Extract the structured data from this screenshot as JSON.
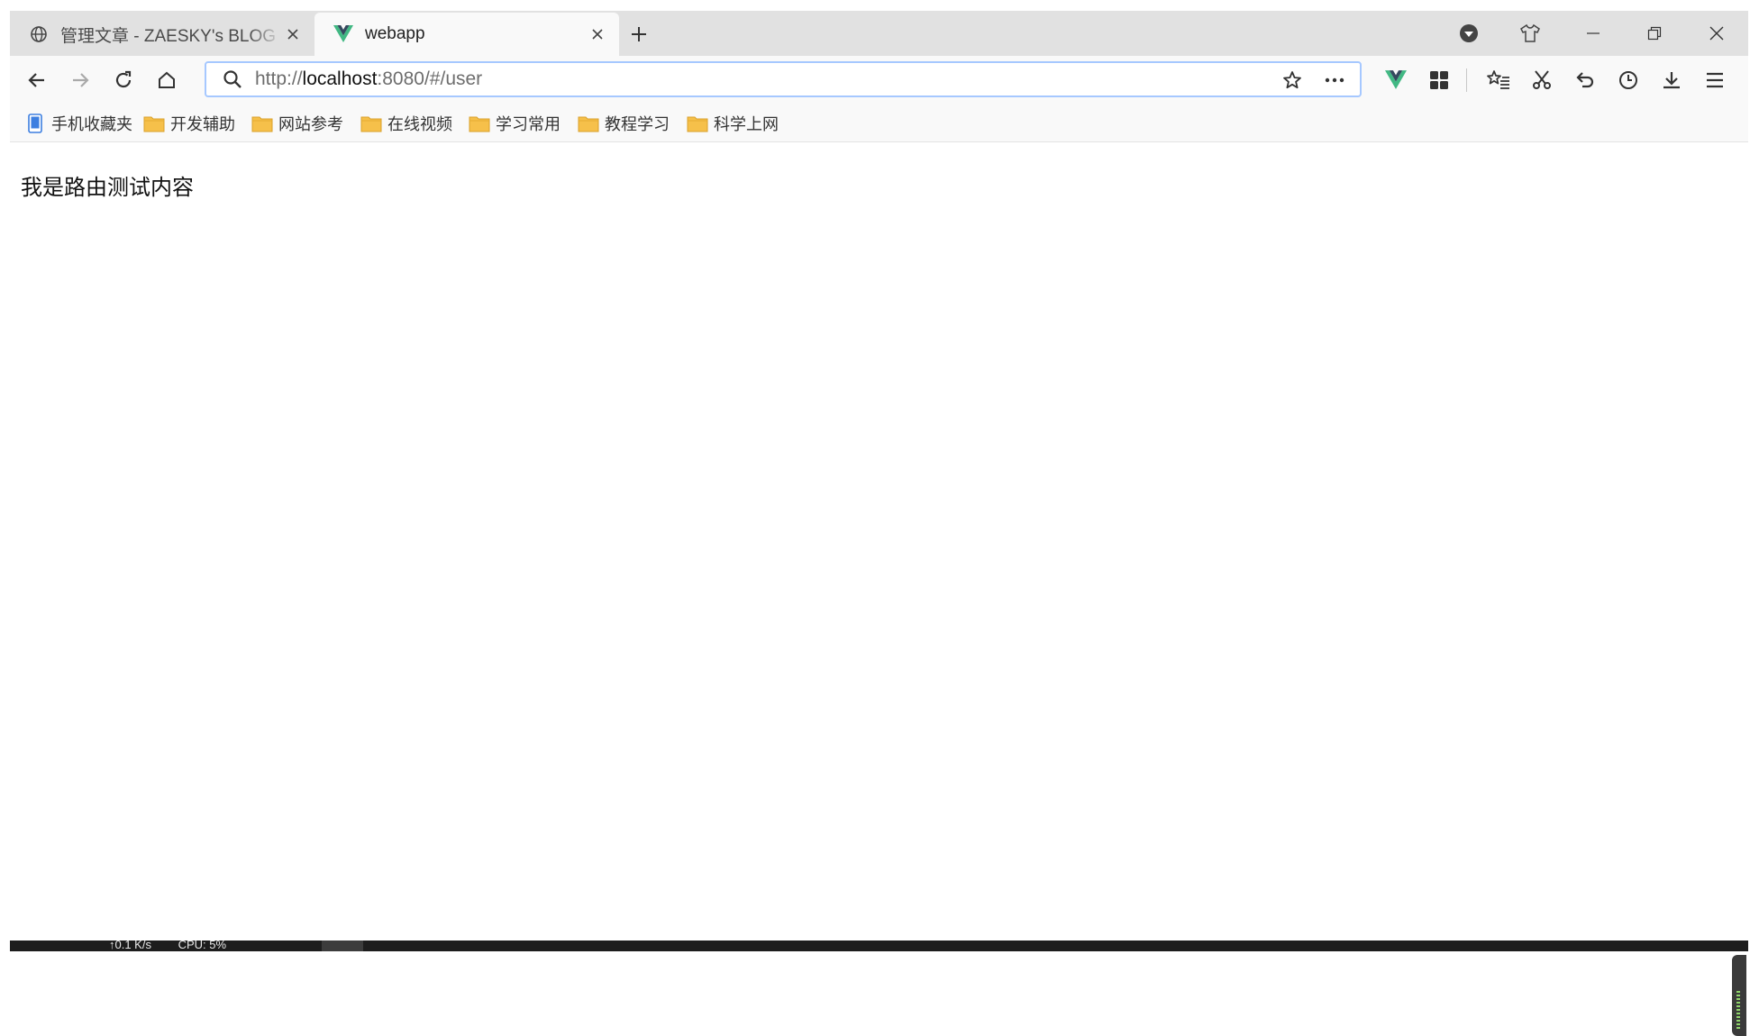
{
  "tabs": [
    {
      "title": "管理文章 - ZAESKY's BLOG - WordPress",
      "icon": "globe-icon",
      "active": false
    },
    {
      "title": "webapp",
      "icon": "vue-logo-icon",
      "active": true
    }
  ],
  "address_bar": {
    "scheme": "http://",
    "host": "localhost",
    "rest": ":8080/#/user"
  },
  "bookmarks": [
    {
      "label": "手机收藏夹",
      "icon": "mobile-bookmark-icon"
    },
    {
      "label": "开发辅助",
      "icon": "folder-icon"
    },
    {
      "label": "网站参考",
      "icon": "folder-icon"
    },
    {
      "label": "在线视频",
      "icon": "folder-icon"
    },
    {
      "label": "学习常用",
      "icon": "folder-icon"
    },
    {
      "label": "教程学习",
      "icon": "folder-icon"
    },
    {
      "label": "科学上网",
      "icon": "folder-icon"
    }
  ],
  "page": {
    "content": "我是路由测试内容"
  },
  "taskbar": {
    "net": "↑0.1 K/s",
    "cpu": "CPU: 5%"
  },
  "colors": {
    "tab_strip": "#e1e1e1",
    "toolbar": "#f9f9f9",
    "url_focus_border": "#a6c8ff",
    "vue_green": "#41b883",
    "vue_dark": "#35495e",
    "folder": "#f6c04a"
  }
}
